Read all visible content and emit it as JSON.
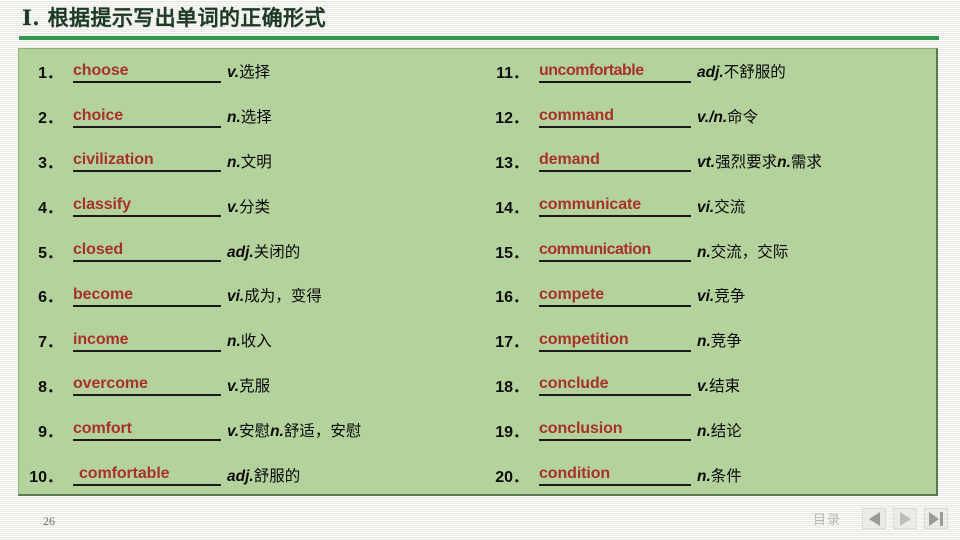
{
  "title": {
    "text": "I. 根据提示写出单词的正确形式"
  },
  "colors": {
    "panel_green": "#b3d29c",
    "rule_green": "#2f9a4e",
    "answer_red": "#a83228",
    "title_green": "#1d3a24"
  },
  "left_column": [
    {
      "number": "1．",
      "answer": "choose",
      "definition_pos": "v.",
      "definition_text": "选择"
    },
    {
      "number": "2．",
      "answer": "choice",
      "definition_pos": "n.",
      "definition_text": "选择"
    },
    {
      "number": "3．",
      "answer": "civilization",
      "definition_pos": "n.",
      "definition_text": "文明"
    },
    {
      "number": "4．",
      "answer": "classify",
      "definition_pos": "v.",
      "definition_text": "分类"
    },
    {
      "number": "5．",
      "answer": "closed",
      "definition_pos": "adj.",
      "definition_text": "关闭的"
    },
    {
      "number": "6．",
      "answer": "become",
      "definition_pos": "vi.",
      "definition_text": "成为，变得"
    },
    {
      "number": "7．",
      "answer": "income",
      "definition_pos": "n.",
      "definition_text": "收入"
    },
    {
      "number": "8．",
      "answer": "overcome",
      "definition_pos": "v.",
      "definition_text": "克服"
    },
    {
      "number": "9．",
      "answer": "comfort",
      "definition_pos": "v.",
      "definition_text": "安慰",
      "definition_pos2": "n.",
      "definition_text2": "舒适，安慰"
    },
    {
      "number": "10．",
      "answer": "comfortable",
      "definition_pos": "adj.",
      "definition_text": "舒服的",
      "indented": true
    }
  ],
  "right_column": [
    {
      "number": "11．",
      "answer": "uncomfortable",
      "definition_pos": "adj.",
      "definition_text": "不舒服的"
    },
    {
      "number": "12．",
      "answer": "command",
      "definition_pos": "v./n.",
      "definition_text": "命令"
    },
    {
      "number": "13．",
      "answer": "demand",
      "definition_pos": "vt.",
      "definition_text": "强烈要求",
      "definition_pos2": "n.",
      "definition_text2": "需求"
    },
    {
      "number": "14．",
      "answer": "communicate",
      "definition_pos": "vi.",
      "definition_text": "交流"
    },
    {
      "number": "15．",
      "answer": "communication",
      "definition_pos": "n.",
      "definition_text": "交流，交际"
    },
    {
      "number": "16．",
      "answer": "compete",
      "definition_pos": "vi.",
      "definition_text": "竞争"
    },
    {
      "number": "17．",
      "answer": "competition",
      "definition_pos": "n.",
      "definition_text": "竞争"
    },
    {
      "number": "18．",
      "answer": "conclude",
      "definition_pos": "v.",
      "definition_text": "结束"
    },
    {
      "number": "19．",
      "answer": "conclusion",
      "definition_pos": "n.",
      "definition_text": "结论"
    },
    {
      "number": "20．",
      "answer": "condition",
      "definition_pos": "n.",
      "definition_text": "条件"
    }
  ],
  "footer": {
    "page_number": "26",
    "contents_label": "目录",
    "nav": {
      "previous": "previous-slide",
      "next": "next-slide",
      "last": "last-slide"
    }
  }
}
